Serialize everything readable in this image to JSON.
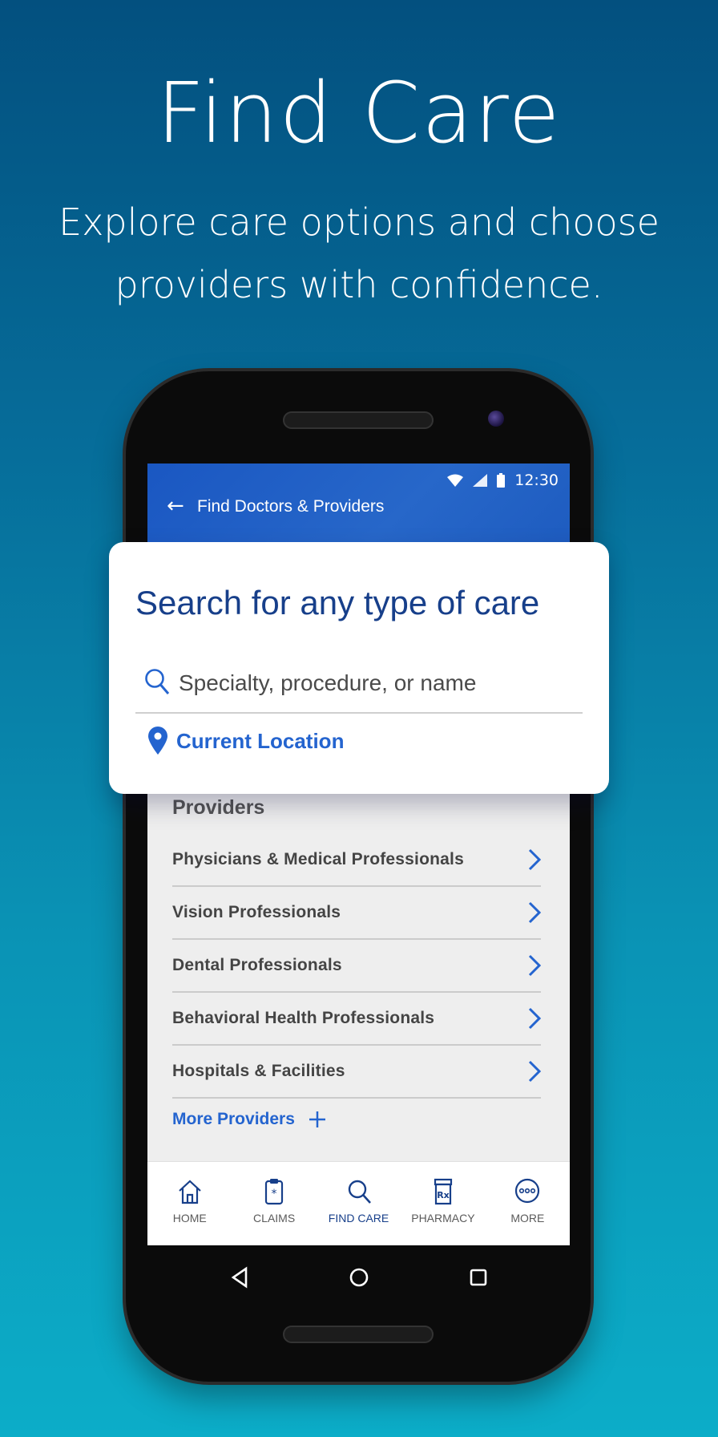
{
  "headline": "Find Care",
  "subline": "Explore care options and choose providers with confidence.",
  "device": {
    "status_time": "12:30",
    "appbar_title": "Find Doctors & Providers"
  },
  "search_card": {
    "title": "Search for any type of care",
    "search_placeholder": "Specialty, procedure, or name",
    "location_label": "Current Location"
  },
  "providers": {
    "heading": "Providers",
    "items": [
      {
        "label": "Physicians & Medical Professionals"
      },
      {
        "label": "Vision Professionals"
      },
      {
        "label": "Dental Professionals"
      },
      {
        "label": "Behavioral Health Professionals"
      },
      {
        "label": "Hospitals & Facilities"
      }
    ],
    "more_label": "More Providers"
  },
  "bottom_nav": {
    "items": [
      {
        "label": "HOME",
        "icon": "home-icon"
      },
      {
        "label": "CLAIMS",
        "icon": "clipboard-icon"
      },
      {
        "label": "FIND CARE",
        "icon": "search-icon"
      },
      {
        "label": "PHARMACY",
        "icon": "pill-bottle-icon"
      },
      {
        "label": "MORE",
        "icon": "more-icon"
      }
    ],
    "active": "FIND CARE"
  },
  "colors": {
    "brand_blue": "#1a57c2",
    "link_blue": "#2464cf",
    "title_navy": "#173f8a"
  }
}
